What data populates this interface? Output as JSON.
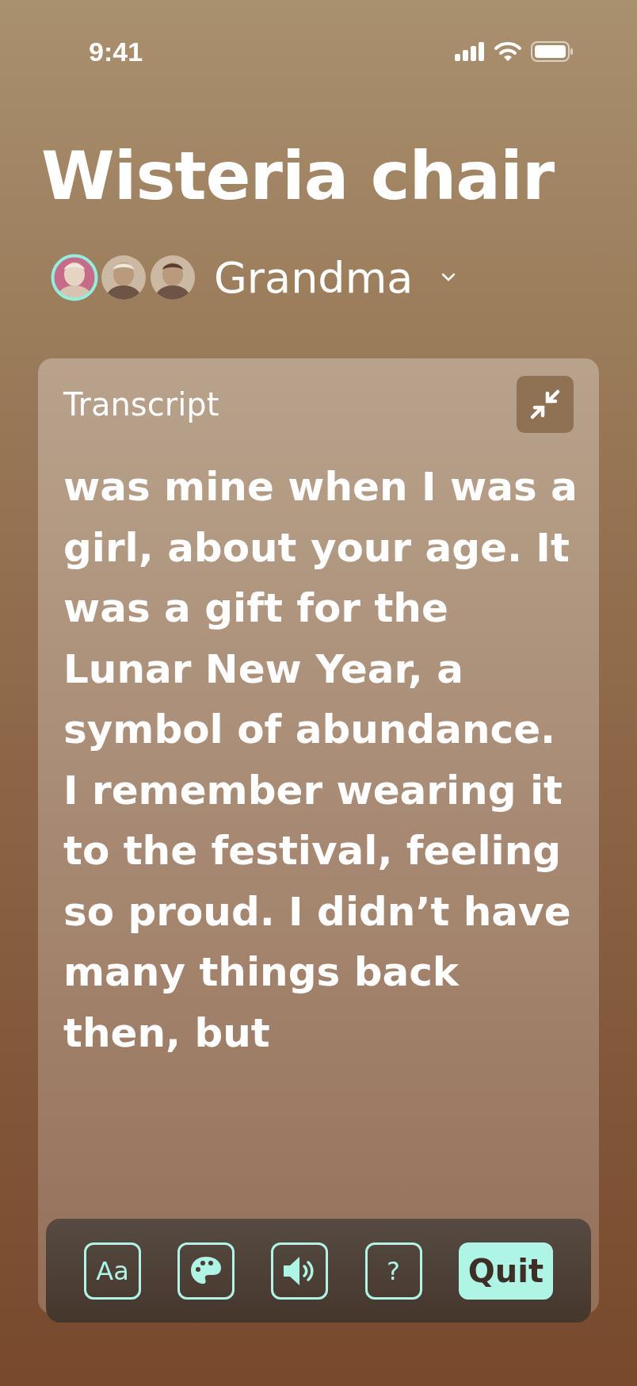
{
  "status_bar": {
    "time": "9:41"
  },
  "title": "Wisteria chair",
  "people": {
    "avatars": [
      {
        "kind": "picture",
        "selected": true
      },
      {
        "kind": "picture",
        "selected": false
      },
      {
        "kind": "picture",
        "selected": false
      }
    ],
    "name": "Grandma"
  },
  "transcript": {
    "label": "Transcript",
    "text": "was mine when I was a girl, about your age. It was a gift for the Lunar New Year, a symbol of abundance. I remember wearing it to the festival, feeling so proud. I didn’t have many things back then, but"
  },
  "toolbar": [
    {
      "kind": "text-size",
      "label": "Aa"
    },
    {
      "kind": "palette"
    },
    {
      "kind": "sound"
    },
    {
      "kind": "help",
      "label": "?"
    },
    {
      "kind": "quit",
      "label": "Quit"
    }
  ]
}
